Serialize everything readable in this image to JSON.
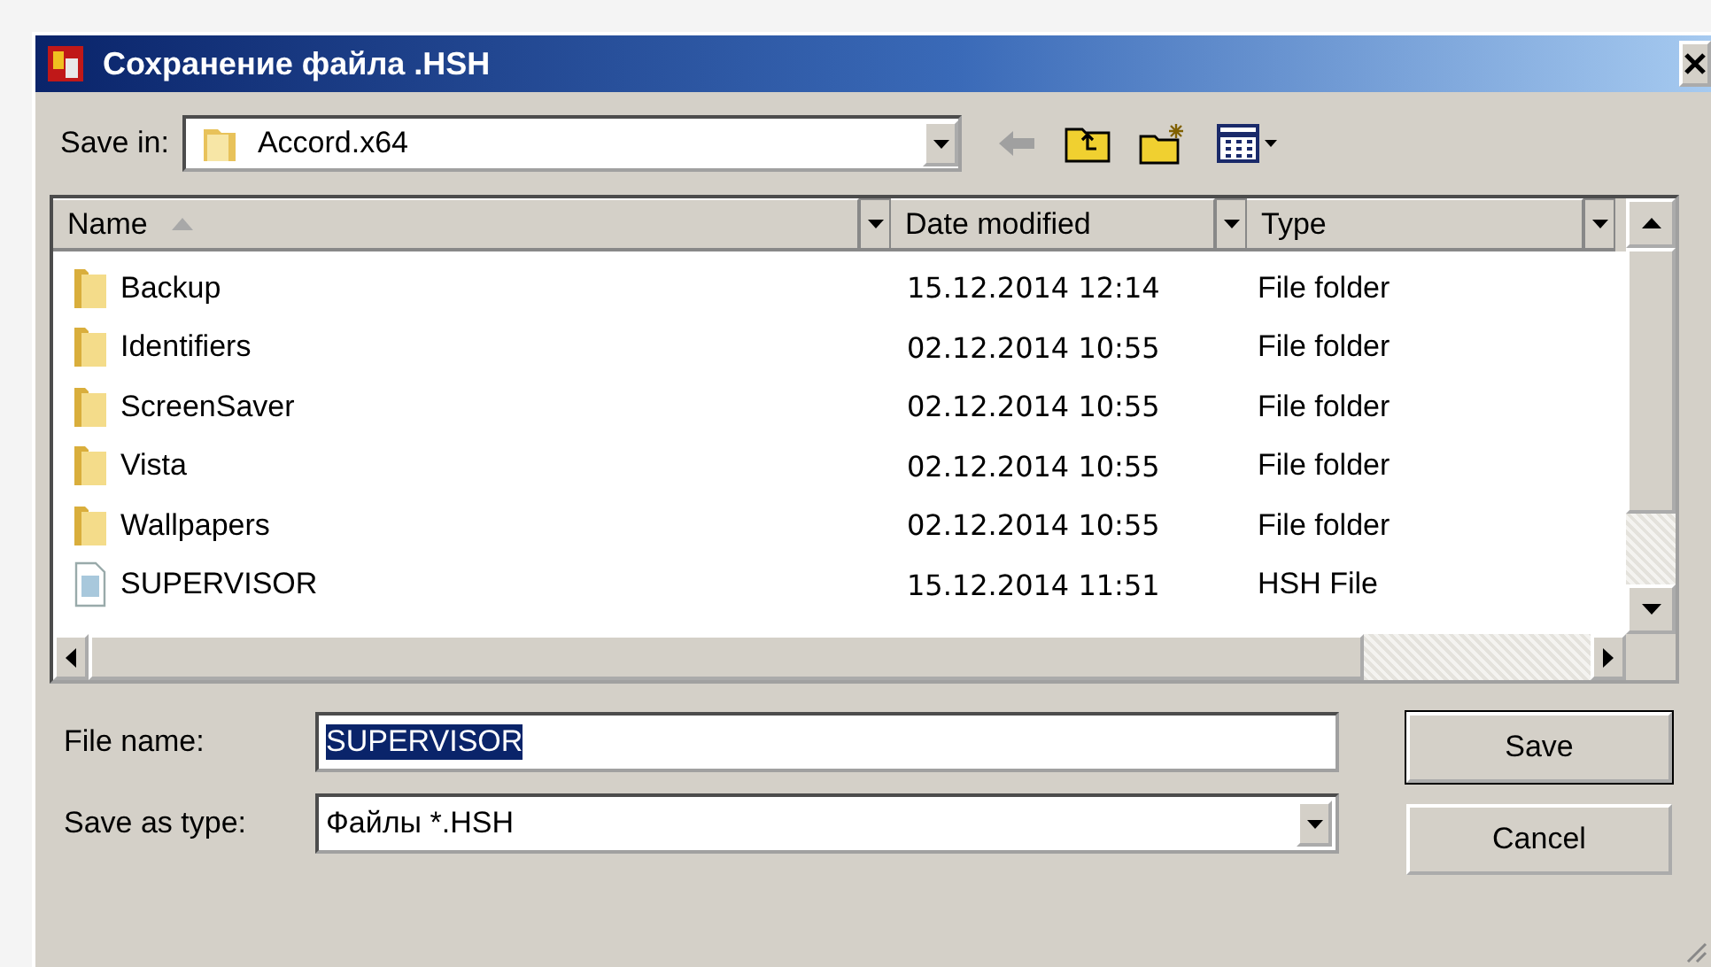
{
  "window": {
    "title": "Сохранение файла .HSH"
  },
  "save_in": {
    "label": "Save in:",
    "value": "Accord.x64"
  },
  "columns": [
    {
      "label": "Name",
      "sorted": true
    },
    {
      "label": "Date modified",
      "sorted": false
    },
    {
      "label": "Type",
      "sorted": false
    }
  ],
  "rows": [
    {
      "kind": "folder",
      "name": "Backup",
      "date": "15.12.2014 12:14",
      "type": "File folder"
    },
    {
      "kind": "folder",
      "name": "Identifiers",
      "date": "02.12.2014 10:55",
      "type": "File folder"
    },
    {
      "kind": "folder",
      "name": "ScreenSaver",
      "date": "02.12.2014 10:55",
      "type": "File folder"
    },
    {
      "kind": "folder",
      "name": "Vista",
      "date": "02.12.2014 10:55",
      "type": "File folder"
    },
    {
      "kind": "folder",
      "name": "Wallpapers",
      "date": "02.12.2014 10:55",
      "type": "File folder"
    },
    {
      "kind": "file",
      "name": "SUPERVISOR",
      "date": "15.12.2014 11:51",
      "type": "HSH File"
    }
  ],
  "file_name": {
    "label": "File name:",
    "value": "SUPERVISOR",
    "selected": true
  },
  "save_as_type": {
    "label": "Save as type:",
    "value": "Файлы  *.HSH"
  },
  "buttons": [
    {
      "label": "Save",
      "default": true
    },
    {
      "label": "Cancel",
      "default": false
    }
  ]
}
